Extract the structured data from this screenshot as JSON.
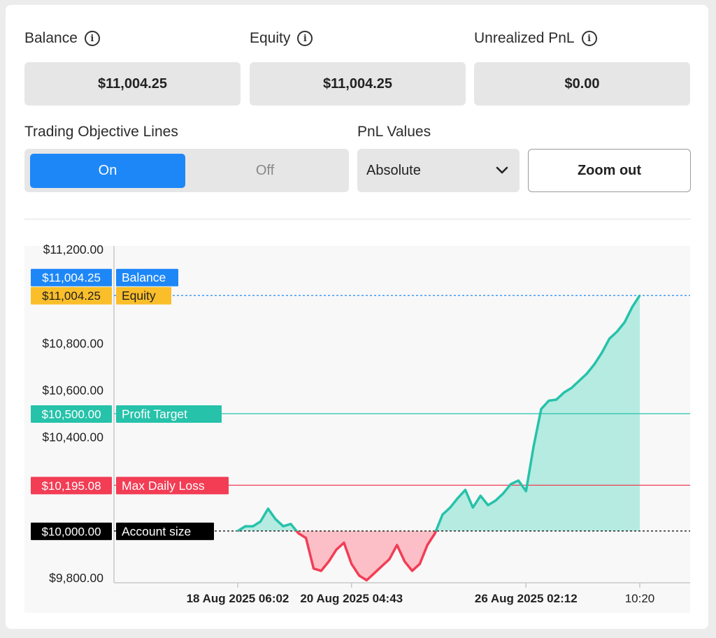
{
  "stats": {
    "balance": {
      "label": "Balance",
      "value": "$11,004.25"
    },
    "equity": {
      "label": "Equity",
      "value": "$11,004.25"
    },
    "unrealized": {
      "label": "Unrealized PnL",
      "value": "$0.00"
    }
  },
  "controls": {
    "objective_label": "Trading Objective Lines",
    "toggle_on": "On",
    "toggle_off": "Off",
    "pnl_label": "PnL Values",
    "pnl_selected": "Absolute",
    "zoom_label": "Zoom out"
  },
  "chart_data": {
    "type": "area",
    "ylim": [
      9780,
      11200
    ],
    "yticks": [
      {
        "value": 11200,
        "label": "$11,200.00"
      },
      {
        "value": 10800,
        "label": "$10,800.00"
      },
      {
        "value": 10600,
        "label": "$10,600.00"
      },
      {
        "value": 10400,
        "label": "$10,400.00"
      },
      {
        "value": 9800,
        "label": "$9,800.00"
      }
    ],
    "xticks": [
      {
        "index": 0,
        "label": "18 Aug 2025 06:02"
      },
      {
        "index": 15,
        "label": "20 Aug 2025 04:43"
      },
      {
        "index": 38,
        "label": "26 Aug 2025 02:12"
      },
      {
        "index": 53,
        "label": "10:20"
      }
    ],
    "lines": [
      {
        "name": "Balance",
        "value": 11004.25,
        "label": "$11,004.25",
        "color": "#1e87f7",
        "style": "dotted"
      },
      {
        "name": "Equity",
        "value": 11004.25,
        "label": "$11,004.25",
        "color": "#f9be2a",
        "style": "none"
      },
      {
        "name": "Profit Target",
        "value": 10500,
        "label": "$10,500.00",
        "color": "#26c2aa",
        "style": "solid"
      },
      {
        "name": "Max Daily Loss",
        "value": 10195.08,
        "label": "$10,195.08",
        "color": "#f23d55",
        "style": "solid"
      },
      {
        "name": "Account size",
        "value": 10000,
        "label": "$10,000.00",
        "color": "#000000",
        "style": "dotted"
      }
    ],
    "baseline": 10000,
    "values": [
      10000,
      10020,
      10020,
      10040,
      10095,
      10050,
      10020,
      10030,
      9990,
      9970,
      9840,
      9830,
      9870,
      9920,
      9950,
      9860,
      9810,
      9790,
      9820,
      9850,
      9880,
      9940,
      9870,
      9830,
      9860,
      9940,
      9990,
      10070,
      10100,
      10140,
      10175,
      10100,
      10150,
      10110,
      10130,
      10160,
      10200,
      10215,
      10170,
      10360,
      10520,
      10555,
      10560,
      10590,
      10610,
      10640,
      10670,
      10710,
      10760,
      10820,
      10850,
      10890,
      10955,
      11004.25
    ],
    "colors": {
      "positive": "#26c2aa",
      "positive_fill": "#b5ebe1",
      "negative": "#f23d55",
      "negative_fill": "#fcbfc7"
    }
  }
}
